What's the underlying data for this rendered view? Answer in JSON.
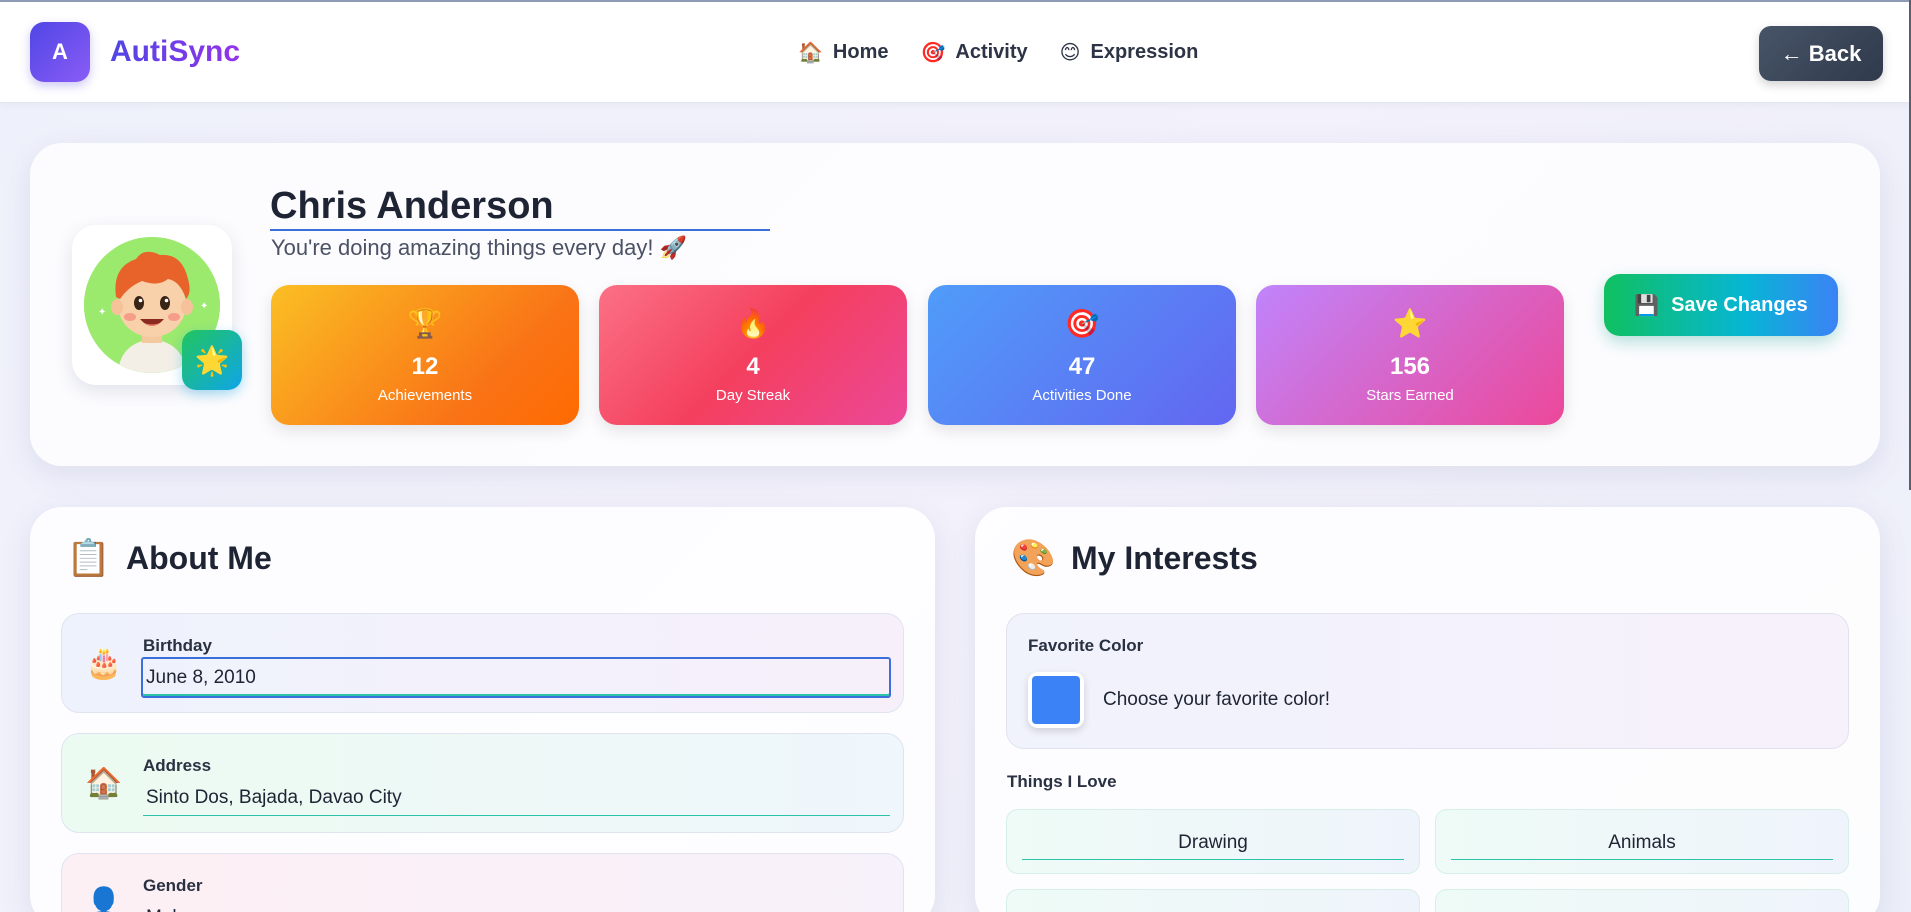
{
  "app": {
    "logo_letter": "A",
    "name": "AutiSync"
  },
  "nav": {
    "items": [
      {
        "icon": "🏠",
        "label": "Home"
      },
      {
        "icon": "🎯",
        "label": "Activity"
      },
      {
        "icon": "😊",
        "label": "Expression"
      }
    ],
    "back_label": "← Back"
  },
  "profile": {
    "name": "Chris Anderson",
    "subtitle": "You're doing amazing things every day! 🚀",
    "badge_icon": "🌟",
    "save_icon": "💾",
    "save_label": "Save Changes",
    "stats": [
      {
        "icon": "🏆",
        "value": "12",
        "label": "Achievements"
      },
      {
        "icon": "🔥",
        "value": "4",
        "label": "Day Streak"
      },
      {
        "icon": "🎯",
        "value": "47",
        "label": "Activities Done"
      },
      {
        "icon": "⭐",
        "value": "156",
        "label": "Stars Earned"
      }
    ]
  },
  "about": {
    "icon": "📋",
    "title": "About Me",
    "fields": [
      {
        "icon": "🎂",
        "label": "Birthday",
        "value": "June 8, 2010"
      },
      {
        "icon": "🏠",
        "label": "Address",
        "value": "Sinto Dos, Bajada, Davao City"
      },
      {
        "icon": "👤",
        "label": "Gender",
        "value": "Male"
      }
    ]
  },
  "interests": {
    "icon": "🎨",
    "title": "My Interests",
    "favorite_color_label": "Favorite Color",
    "favorite_color_value": "#3b82f6",
    "favorite_color_hint": "Choose your favorite color!",
    "things_label": "Things I Love",
    "things": [
      "Drawing",
      "Animals",
      "",
      ""
    ]
  }
}
